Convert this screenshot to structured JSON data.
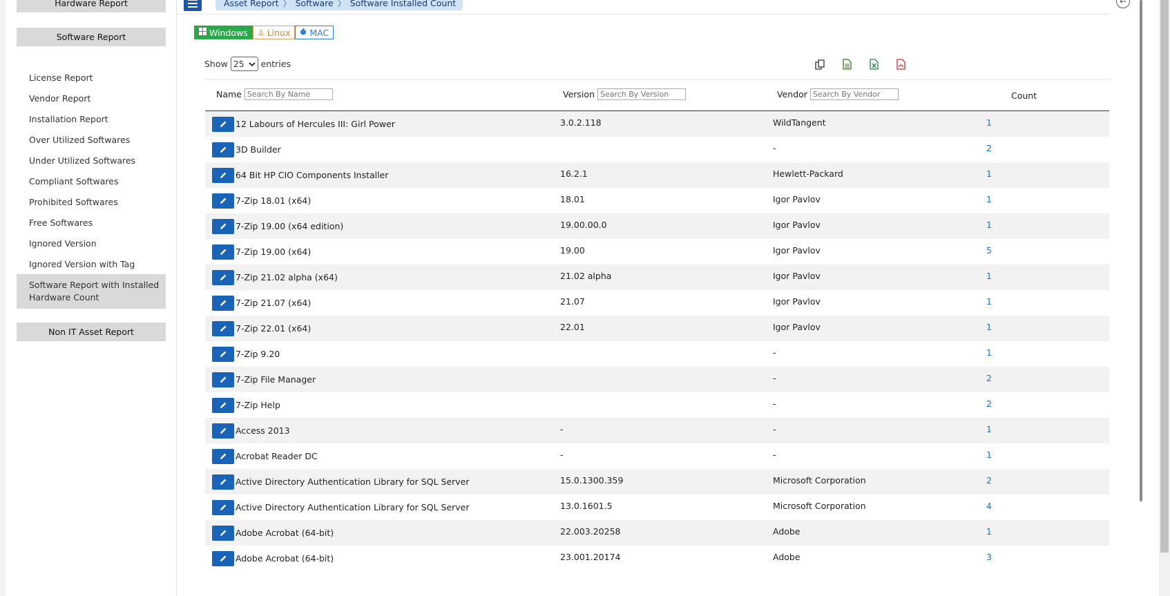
{
  "sidebar": {
    "hardware_report": "Hardware Report",
    "software_report": "Software Report",
    "non_it_asset_report": "Non IT Asset Report",
    "items": [
      {
        "label": "License Report"
      },
      {
        "label": "Vendor Report"
      },
      {
        "label": "Installation Report"
      },
      {
        "label": "Over Utilized Softwares"
      },
      {
        "label": "Under Utilized Softwares"
      },
      {
        "label": "Compliant Softwares"
      },
      {
        "label": "Prohibited Softwares"
      },
      {
        "label": "Free Softwares"
      },
      {
        "label": "Ignored Version"
      },
      {
        "label": "Ignored Version with Tag"
      },
      {
        "label": "Software Report with Installed Hardware Count",
        "active": true
      }
    ]
  },
  "breadcrumb": [
    "Asset Report",
    "Software",
    "Software Installed Count"
  ],
  "os_tabs": {
    "windows": "Windows",
    "linux": "Linux",
    "mac": "MAC"
  },
  "show": {
    "prefix": "Show",
    "value": "25",
    "suffix": "entries"
  },
  "export_icons": [
    "copy-icon",
    "csv-icon",
    "excel-icon",
    "pdf-icon"
  ],
  "table": {
    "headers": {
      "name": "Name",
      "name_placeholder": "Search By Name",
      "version": "Version",
      "version_placeholder": "Search By Version",
      "vendor": "Vendor",
      "vendor_placeholder": "Search By Vendor",
      "count": "Count"
    },
    "rows": [
      {
        "name": "12 Labours of Hercules III: Girl Power",
        "version": "3.0.2.118",
        "vendor": "WildTangent",
        "count": "1"
      },
      {
        "name": "3D Builder",
        "version": "",
        "vendor": "-",
        "count": "2"
      },
      {
        "name": "64 Bit HP CIO Components Installer",
        "version": "16.2.1",
        "vendor": "Hewlett-Packard",
        "count": "1"
      },
      {
        "name": "7-Zip 18.01 (x64)",
        "version": "18.01",
        "vendor": "Igor Pavlov",
        "count": "1"
      },
      {
        "name": "7-Zip 19.00 (x64 edition)",
        "version": "19.00.00.0",
        "vendor": "Igor Pavlov",
        "count": "1"
      },
      {
        "name": "7-Zip 19.00 (x64)",
        "version": "19.00",
        "vendor": "Igor Pavlov",
        "count": "5"
      },
      {
        "name": "7-Zip 21.02 alpha (x64)",
        "version": "21.02 alpha",
        "vendor": "Igor Pavlov",
        "count": "1"
      },
      {
        "name": "7-Zip 21.07 (x64)",
        "version": "21.07",
        "vendor": "Igor Pavlov",
        "count": "1"
      },
      {
        "name": "7-Zip 22.01 (x64)",
        "version": "22.01",
        "vendor": "Igor Pavlov",
        "count": "1"
      },
      {
        "name": "7-Zip 9.20",
        "version": "",
        "vendor": "-",
        "count": "1"
      },
      {
        "name": "7-Zip File Manager",
        "version": "",
        "vendor": "-",
        "count": "2"
      },
      {
        "name": "7-Zip Help",
        "version": "",
        "vendor": "-",
        "count": "2"
      },
      {
        "name": "Access 2013",
        "version": "-",
        "vendor": "-",
        "count": "1"
      },
      {
        "name": "Acrobat Reader DC",
        "version": "-",
        "vendor": "-",
        "count": "1"
      },
      {
        "name": "Active Directory Authentication Library for SQL Server",
        "version": "15.0.1300.359",
        "vendor": "Microsoft Corporation",
        "count": "2"
      },
      {
        "name": "Active Directory Authentication Library for SQL Server",
        "version": "13.0.1601.5",
        "vendor": "Microsoft Corporation",
        "count": "4"
      },
      {
        "name": "Adobe Acrobat (64-bit)",
        "version": "22.003.20258",
        "vendor": "Adobe",
        "count": "1"
      },
      {
        "name": "Adobe Acrobat (64-bit)",
        "version": "23.001.20174",
        "vendor": "Adobe",
        "count": "3"
      }
    ]
  },
  "colors": {
    "accent": "#1a64b8",
    "windows": "#2aa84a",
    "linux": "#e67e22",
    "mac": "#2f7fd6",
    "link": "#1a6fd1"
  }
}
